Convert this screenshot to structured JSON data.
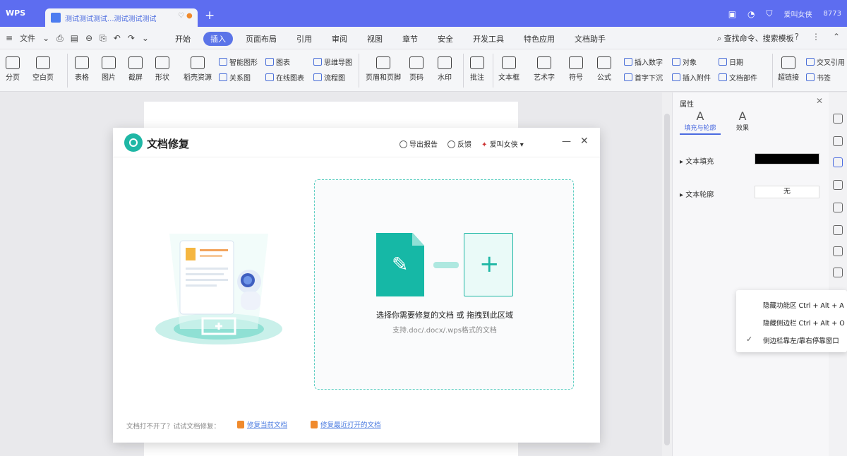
{
  "titlebar": {
    "logo": "WPS",
    "doc_tab_title": "测试测试测试...测试测试测试",
    "new_tab": "+",
    "user_name": "爱叫女侠",
    "badge": "8773"
  },
  "menu": {
    "file": "文件",
    "tabs": [
      "开始",
      "插入",
      "页面布局",
      "引用",
      "审阅",
      "视图",
      "章节",
      "安全",
      "开发工具",
      "特色应用",
      "文档助手"
    ],
    "active_tab": "插入",
    "search": "查找命令、搜索模板"
  },
  "ribbon": {
    "large": [
      {
        "label": "分页",
        "icon": "page-break-icon"
      },
      {
        "label": "空白页",
        "icon": "blank-page-icon"
      },
      {
        "label": "表格",
        "icon": "table-icon"
      },
      {
        "label": "图片",
        "icon": "picture-icon"
      },
      {
        "label": "截屏",
        "icon": "screenshot-icon"
      },
      {
        "label": "形状",
        "icon": "shape-icon"
      },
      {
        "label": "稻壳资源",
        "icon": "resource-icon"
      },
      {
        "label": "页眉和页脚",
        "icon": "header-footer-icon"
      },
      {
        "label": "页码",
        "icon": "page-number-icon"
      },
      {
        "label": "水印",
        "icon": "watermark-icon"
      },
      {
        "label": "批注",
        "icon": "comment-icon"
      },
      {
        "label": "文本框",
        "icon": "textbox-icon"
      },
      {
        "label": "艺术字",
        "icon": "wordart-icon"
      },
      {
        "label": "符号",
        "icon": "symbol-icon"
      },
      {
        "label": "公式",
        "icon": "formula-icon"
      },
      {
        "label": "超链接",
        "icon": "hyperlink-icon"
      }
    ],
    "small": [
      {
        "label": "智能图形"
      },
      {
        "label": "图表"
      },
      {
        "label": "关系图"
      },
      {
        "label": "在线图表"
      },
      {
        "label": "思维导图"
      },
      {
        "label": "流程图"
      },
      {
        "label": "插入数字"
      },
      {
        "label": "对象"
      },
      {
        "label": "日期"
      },
      {
        "label": "首字下沉"
      },
      {
        "label": "插入附件"
      },
      {
        "label": "文档部件"
      },
      {
        "label": "交叉引用"
      },
      {
        "label": "书签"
      }
    ]
  },
  "panel": {
    "title": "属性",
    "tabs": [
      "填充与轮廓",
      "效果"
    ],
    "fill_label": "文本填充",
    "outline_label": "文本轮廓",
    "outline_value": "无",
    "fill_color": "#000000"
  },
  "context_menu": {
    "items": [
      "隐藏功能区 Ctrl + Alt + A",
      "隐藏侧边栏 Ctrl + Alt + O",
      "侧边栏靠左/靠右停靠窗口"
    ]
  },
  "dialog": {
    "title": "文档修复",
    "actions": [
      "导出报告",
      "反馈",
      "爱叫女侠"
    ],
    "drop_text": "选择你需要修复的文档 或 拖拽到此区域",
    "drop_sub": "支持.doc/.docx/.wps格式的文档",
    "footer_text": "文档打不开了？试试文档修复：",
    "links": [
      "修复当前文档",
      "修复最近打开的文档"
    ]
  }
}
